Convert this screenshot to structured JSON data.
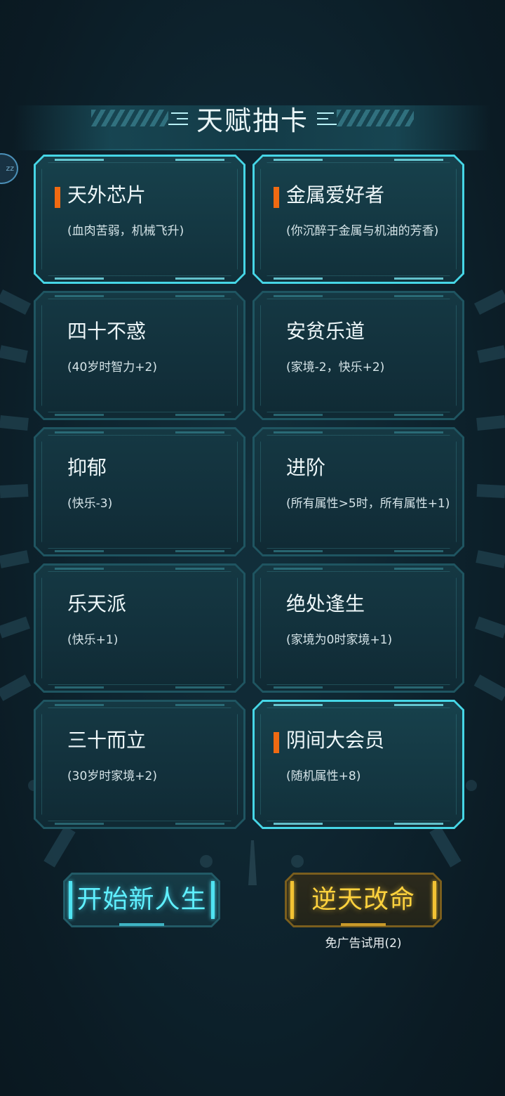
{
  "header": {
    "title": "天赋抽卡"
  },
  "side_button": {
    "text": "zz"
  },
  "talents": [
    {
      "name": "天外芯片",
      "desc": "(血肉苦弱，机械飞升)",
      "selected": true
    },
    {
      "name": "金属爱好者",
      "desc": "(你沉醉于金属与机油的芳香)",
      "selected": true
    },
    {
      "name": "四十不惑",
      "desc": "(40岁时智力+2)",
      "selected": false
    },
    {
      "name": "安贫乐道",
      "desc": "(家境-2，快乐+2)",
      "selected": false
    },
    {
      "name": "抑郁",
      "desc": "(快乐-3)",
      "selected": false
    },
    {
      "name": "进阶",
      "desc": "(所有属性>5时，所有属性+1)",
      "selected": false
    },
    {
      "name": "乐天派",
      "desc": "(快乐+1)",
      "selected": false
    },
    {
      "name": "绝处逢生",
      "desc": "(家境为0时家境+1)",
      "selected": false
    },
    {
      "name": "三十而立",
      "desc": "(30岁时家境+2)",
      "selected": false
    },
    {
      "name": "阴间大会员",
      "desc": "(随机属性+8)",
      "selected": true
    }
  ],
  "actions": {
    "start_label": "开始新人生",
    "fate_label": "逆天改命",
    "fate_note": "免广告试用(2)"
  },
  "colors": {
    "background": "#0c1d27",
    "selected_border": "#46d6e6",
    "marker": "#f06a12",
    "start_text": "#5ff0ff",
    "fate_text": "#ffd23d"
  }
}
